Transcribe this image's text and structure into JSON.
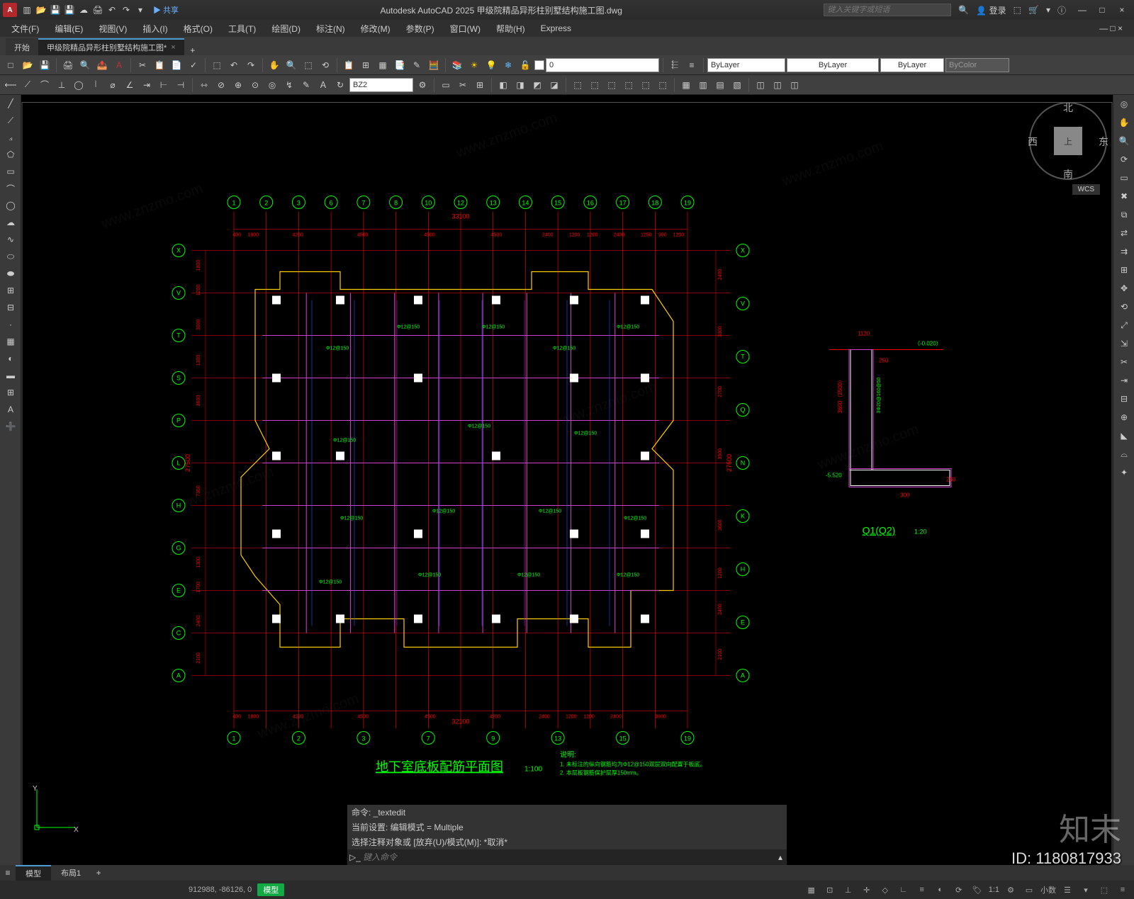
{
  "app": {
    "title": "Autodesk AutoCAD 2025   甲级院精品异形柱别墅结构施工图.dwg",
    "logo_letter": "A",
    "share": "▶ 共享",
    "search_placeholder": "键入关键字或短语",
    "login": "登录"
  },
  "winbuttons": {
    "min": "—",
    "max": "□",
    "close": "×",
    "help": "?"
  },
  "menubar": [
    "文件(F)",
    "编辑(E)",
    "视图(V)",
    "插入(I)",
    "格式(O)",
    "工具(T)",
    "绘图(D)",
    "标注(N)",
    "修改(M)",
    "参数(P)",
    "窗口(W)",
    "帮助(H)",
    "Express"
  ],
  "filetabs": {
    "start": "开始",
    "active": "甲级院精品异形柱别墅结构施工图*"
  },
  "toolbar": {
    "layer_current": "0",
    "linetype": "ByLayer",
    "lineweight": "ByLayer",
    "plotstyle": "ByColor",
    "layer_bylayer": "ByLayer",
    "dimstyle": "BZ2"
  },
  "viewcube": {
    "top": "上",
    "n": "北",
    "s": "南",
    "e": "东",
    "w": "西",
    "wcs": "WCS"
  },
  "drawing": {
    "title": "地下室底板配筋平面图",
    "scale": "1:100",
    "note_header": "说明:",
    "notes": [
      "1. 未标注的纵向钢筋均为Φ12@150双层双向配置于板底。",
      "2. 本层板钢筋保护层厚150mm。"
    ],
    "overall_dim_top": "33100",
    "overall_dim_bottom": "32100",
    "overall_dim_left": "27500",
    "overall_dim_right": "27500",
    "top_dims": [
      "400",
      "1800",
      "4200",
      "4500",
      "4500",
      "4500",
      "2400",
      "1200",
      "1200",
      "2400",
      "1250",
      "950",
      "1200"
    ],
    "bottom_dims": [
      "400",
      "1800",
      "4200",
      "4500",
      "4500",
      "4200",
      "2400",
      "1200",
      "1200",
      "2400",
      "3600"
    ],
    "left_dims": [
      "1800",
      "1200",
      "3000",
      "1300",
      "3600",
      "7350",
      "1300",
      "1700",
      "2400",
      "2100"
    ],
    "right_dims": [
      "2400",
      "3300",
      "2700",
      "3500",
      "3600",
      "1200",
      "2400",
      "2100"
    ],
    "top_bubbles": [
      "1",
      "2",
      "3",
      "6",
      "7",
      "8",
      "10",
      "12",
      "13",
      "14",
      "15",
      "16",
      "17",
      "18",
      "19"
    ],
    "bottom_bubbles": [
      "1",
      "2",
      "3",
      "7",
      "9",
      "13",
      "15",
      "19"
    ],
    "left_bubbles": [
      "X",
      "V",
      "T",
      "S",
      "P",
      "L",
      "H",
      "G",
      "E",
      "C",
      "A"
    ],
    "right_bubbles": [
      "X",
      "V",
      "T",
      "Q",
      "N",
      "K",
      "H",
      "E",
      "A"
    ],
    "rebar_label": "Φ12@150",
    "detail": {
      "title": "Q1(Q2)",
      "scale": "1:20",
      "elev1": "（-0.020）",
      "elev2": "-5.520",
      "dim1": "250",
      "dim2": "1120",
      "dim3": "300",
      "dim4": "3600（2500）",
      "dim5": "250",
      "rebar": "3Φ20@160@50"
    }
  },
  "command": {
    "hist1": "命令: _textedit",
    "hist2": "当前设置: 编辑模式 = Multiple",
    "hist3": "选择注释对象或 [放弃(U)/模式(M)]: *取消*",
    "placeholder": "键入命令"
  },
  "modeltabs": {
    "model": "模型",
    "layout": "布局1"
  },
  "statusbar": {
    "coords": "912988, -86126, 0",
    "mode": "模型",
    "scale": "1:1",
    "deci": "小数"
  },
  "watermark": {
    "id": "ID: 1180817933",
    "brand": "知末",
    "site": "www.znzmo.com"
  }
}
